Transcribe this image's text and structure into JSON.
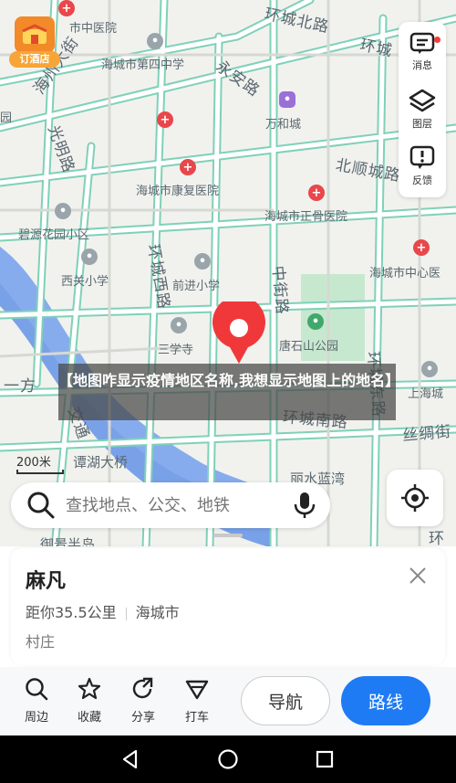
{
  "map": {
    "roads": [
      {
        "key": "haizhou",
        "text": "海州大街"
      },
      {
        "key": "huancheng_n",
        "text": "环城北路"
      },
      {
        "key": "huancheng_n2",
        "text": "环城"
      },
      {
        "key": "yongan",
        "text": "永安路"
      },
      {
        "key": "guangming",
        "text": "光明路"
      },
      {
        "key": "beishun",
        "text": "北顺城路"
      },
      {
        "key": "huancheng_w",
        "text": "环城西路"
      },
      {
        "key": "zhongjie",
        "text": "中街路"
      },
      {
        "key": "huancheng_e",
        "text": "环城东路"
      },
      {
        "key": "huancheng_s",
        "text": "环城南路"
      },
      {
        "key": "jiaotong",
        "text": "交通"
      },
      {
        "key": "silk",
        "text": "丝绸街"
      },
      {
        "key": "yifang",
        "text": "一方"
      },
      {
        "key": "huan2",
        "text": "环"
      }
    ],
    "pois": [
      {
        "key": "zhongyi",
        "text": "市中医院"
      },
      {
        "key": "zhongxue4",
        "text": "海城市第四中学"
      },
      {
        "key": "wanhe",
        "text": "万和城"
      },
      {
        "key": "kangfu",
        "text": "海城市康复医院"
      },
      {
        "key": "zhenggu",
        "text": "海城市正骨医院"
      },
      {
        "key": "biyuan",
        "text": "碧源花园小区"
      },
      {
        "key": "zhongxin",
        "text": "海城市中心医"
      },
      {
        "key": "xiguan",
        "text": "西关小学"
      },
      {
        "key": "qianjin",
        "text": "前进小学"
      },
      {
        "key": "sanxue",
        "text": "三学寺"
      },
      {
        "key": "tangshishan",
        "text": "唐石山公园"
      },
      {
        "key": "shanghai",
        "text": "上海城"
      },
      {
        "key": "tanhuhe",
        "text": "谭湖大桥"
      },
      {
        "key": "lishui",
        "text": "丽水蓝湾"
      },
      {
        "key": "yujing",
        "text": "御景半岛"
      },
      {
        "key": "yuan",
        "text": "园"
      }
    ]
  },
  "hotel": {
    "label": "订酒店"
  },
  "tools": {
    "messages": "消息",
    "layers": "图层",
    "feedback": "反馈"
  },
  "caption": "【地图咋显示疫情地区名称,我想显示地图上的地名】",
  "scale": {
    "label": "200米"
  },
  "search": {
    "placeholder": "查找地点、公交、地铁"
  },
  "place": {
    "name": "麻凡",
    "distance": "距你35.5公里",
    "city": "海城市",
    "type": "村庄"
  },
  "actions": {
    "nearby": "周边",
    "favorite": "收藏",
    "share": "分享",
    "taxi": "打车",
    "navigate": "导航",
    "route": "路线"
  },
  "colors": {
    "accent": "#1f7bf4",
    "pin": "#f0383a",
    "water": "#5f8fe0",
    "park": "#b9e0c2"
  }
}
